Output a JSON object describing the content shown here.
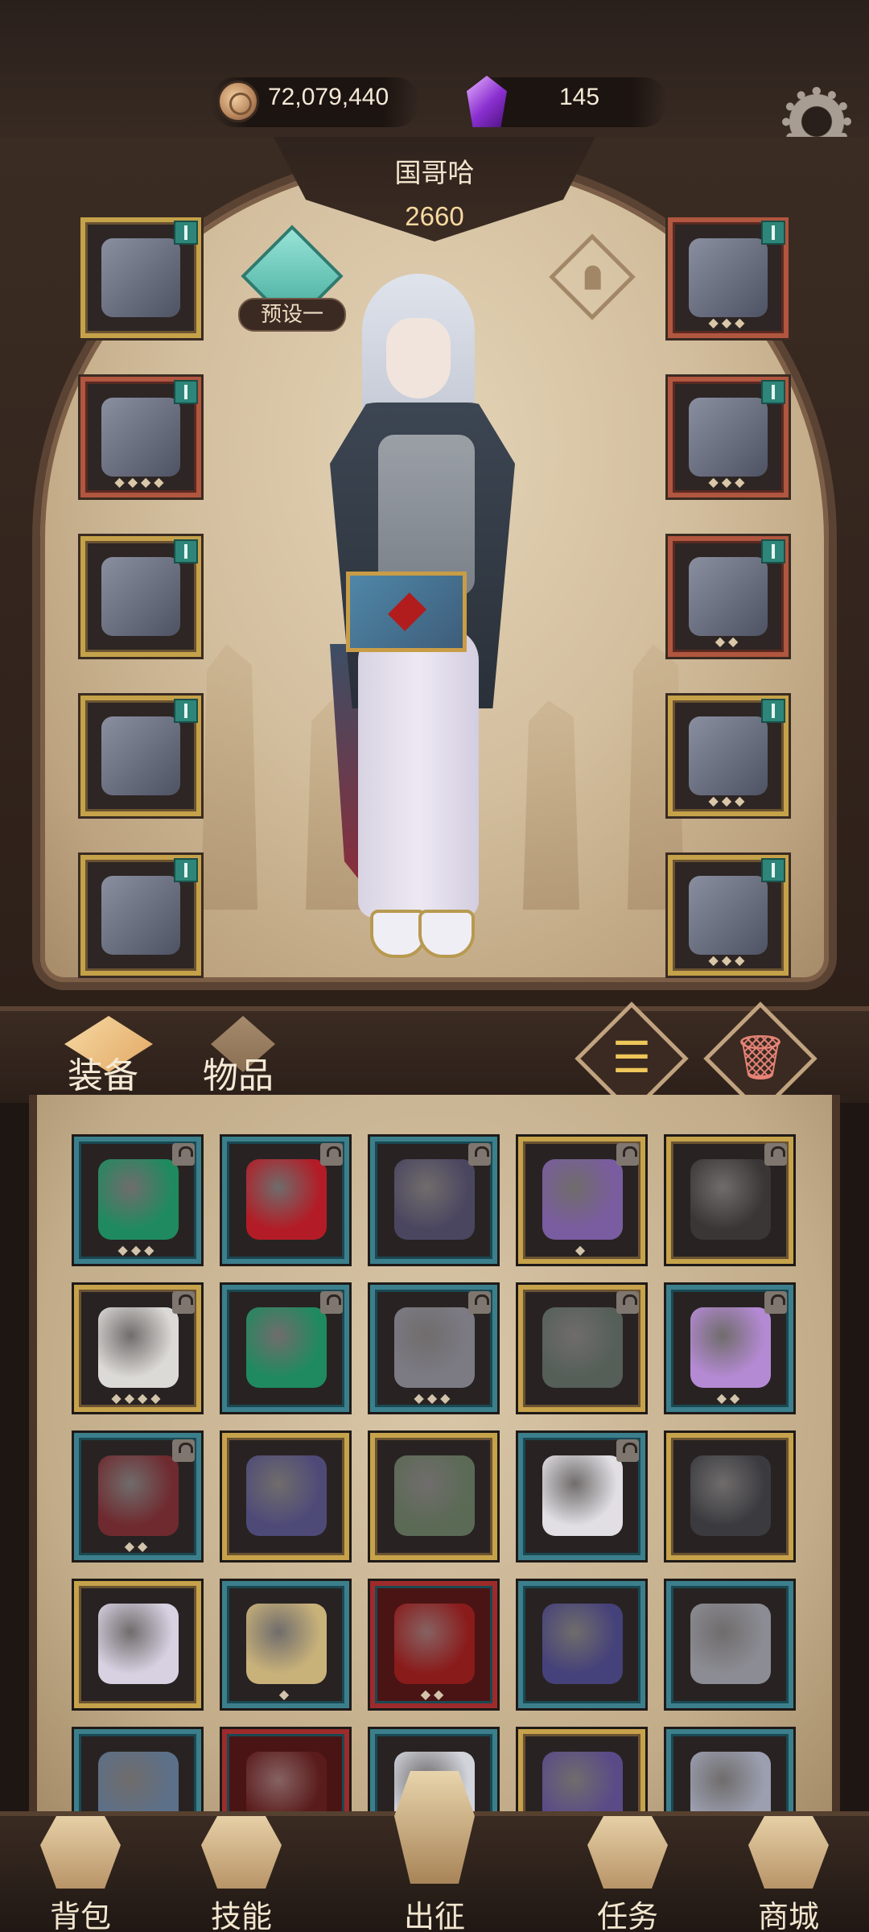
{
  "currency": {
    "gold": "72,079,440",
    "gems": "145"
  },
  "icons": {
    "coin": "coin-icon",
    "gem": "gem-icon",
    "settings": "gear-icon",
    "preset": "preset-emblem-icon",
    "gender": "gender-female-icon",
    "sort": "sort-icon",
    "trash": "trash-icon"
  },
  "hero": {
    "name": "国哥哈",
    "power": "2660",
    "preset_label": "预设一"
  },
  "equipped": {
    "left": [
      {
        "name": "crown-icon",
        "frame": "gold"
      },
      {
        "name": "chest-armor-icon",
        "frame": "red",
        "dots": "◆◆◆◆"
      },
      {
        "name": "gloves-icon",
        "frame": "gold"
      },
      {
        "name": "pants-icon",
        "frame": "gold"
      },
      {
        "name": "boots-icon",
        "frame": "gold"
      }
    ],
    "right": [
      {
        "name": "amulet-icon",
        "frame": "red",
        "dots": "◆◆◆"
      },
      {
        "name": "ring-icon",
        "frame": "red",
        "dots": "◆◆◆"
      },
      {
        "name": "ruby-ring-icon",
        "frame": "red",
        "dots": "◆◆"
      },
      {
        "name": "staff-icon",
        "frame": "gold",
        "dots": "◆◆◆"
      },
      {
        "name": "spellbook-icon",
        "frame": "gold",
        "dots": "◆◆◆"
      }
    ]
  },
  "tabs": {
    "equipment": "装备",
    "items": "物品"
  },
  "inventory": [
    {
      "name": "emerald-amulet-icon",
      "frame": "teal",
      "lock": true,
      "dots": "◆◆◆",
      "color": "#1f8a5f"
    },
    {
      "name": "ruby-heart-amulet-icon",
      "frame": "teal",
      "lock": true,
      "dots": "",
      "color": "#b31c26"
    },
    {
      "name": "obsidian-pendant-icon",
      "frame": "teal",
      "lock": true,
      "dots": "",
      "color": "#4b4660"
    },
    {
      "name": "amethyst-pendant-icon",
      "frame": "gold",
      "lock": true,
      "dots": "◆",
      "color": "#7a5ca0"
    },
    {
      "name": "dark-pants-icon",
      "frame": "gold",
      "lock": true,
      "dots": "",
      "color": "#3a3636"
    },
    {
      "name": "white-gloves-icon",
      "frame": "gold",
      "lock": true,
      "dots": "◆◆◆◆",
      "color": "#dcdad6"
    },
    {
      "name": "emerald-amulet-icon",
      "frame": "teal",
      "lock": true,
      "dots": "",
      "color": "#1f8a5f"
    },
    {
      "name": "bone-spine-icon",
      "frame": "teal",
      "lock": true,
      "dots": "◆◆◆",
      "color": "#7c7b84"
    },
    {
      "name": "vest-armor-icon",
      "frame": "gold",
      "lock": true,
      "dots": "",
      "color": "#555f58"
    },
    {
      "name": "lavender-dress-icon",
      "frame": "teal",
      "lock": true,
      "dots": "◆◆",
      "color": "#b58ad4"
    },
    {
      "name": "crimson-dress-icon",
      "frame": "teal",
      "lock": true,
      "dots": "◆◆",
      "color": "#6f2a2f"
    },
    {
      "name": "dragon-helm-icon",
      "frame": "gold",
      "lock": false,
      "dots": "",
      "color": "#4e4a78"
    },
    {
      "name": "mossy-gauntlets-icon",
      "frame": "gold",
      "lock": false,
      "dots": "",
      "color": "#5b6a55"
    },
    {
      "name": "white-breeches-icon",
      "frame": "teal",
      "lock": true,
      "dots": "",
      "color": "#e1dfe4"
    },
    {
      "name": "lightning-crown-icon",
      "frame": "gold",
      "lock": false,
      "dots": "",
      "color": "#3b3b3f"
    },
    {
      "name": "rose-dress-icon",
      "frame": "gold",
      "lock": false,
      "dots": "",
      "color": "#d7d1e2"
    },
    {
      "name": "golden-scepter-icon",
      "frame": "teal",
      "lock": false,
      "dots": "◆",
      "color": "#c9b27a"
    },
    {
      "name": "crimson-robe-icon",
      "frame": "crimson",
      "lock": false,
      "dots": "◆◆",
      "color": "#8a1b1b"
    },
    {
      "name": "star-tunic-icon",
      "frame": "teal",
      "lock": false,
      "dots": "",
      "color": "#45417a"
    },
    {
      "name": "star-ring-icon",
      "frame": "teal",
      "lock": false,
      "dots": "",
      "color": "#8c8c94"
    },
    {
      "name": "crystal-staff-icon",
      "frame": "teal",
      "lock": false,
      "dots": "",
      "color": "#5c7089"
    },
    {
      "name": "red-boots-icon",
      "frame": "crimson",
      "lock": false,
      "dots": "",
      "color": "#5a1b1b"
    },
    {
      "name": "pearl-earrings-icon",
      "frame": "teal",
      "lock": false,
      "dots": "",
      "color": "#d2d4dc"
    },
    {
      "name": "purple-helm-icon",
      "frame": "gold",
      "lock": false,
      "dots": "",
      "color": "#5a4a88"
    },
    {
      "name": "moon-pendant-icon",
      "frame": "teal",
      "lock": false,
      "dots": "",
      "color": "#9b9fb0"
    }
  ],
  "nav": [
    {
      "label": "背包",
      "icon": "backpack-icon"
    },
    {
      "label": "技能",
      "icon": "skill-book-icon"
    },
    {
      "label": "出征",
      "icon": "expedition-banner-icon"
    },
    {
      "label": "任务",
      "icon": "quest-scroll-icon"
    },
    {
      "label": "商城",
      "icon": "shop-crown-icon"
    }
  ]
}
